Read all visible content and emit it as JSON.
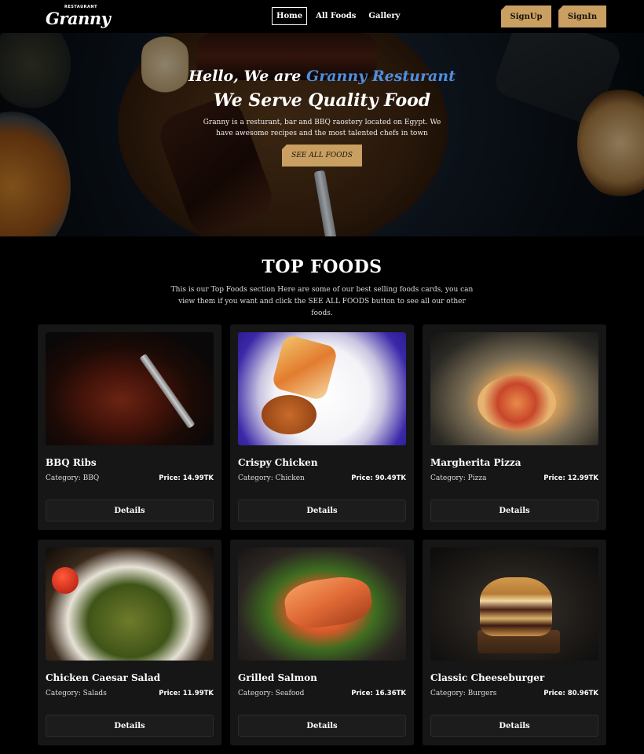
{
  "nav": {
    "logo_small": "RESTAURANT",
    "logo_big": "Granny",
    "links": [
      "Home",
      "All Foods",
      "Gallery"
    ],
    "signup": "SignUp",
    "signin": "SignIn"
  },
  "hero": {
    "title_prefix": "Hello, We are ",
    "title_brand": "Granny Resturant",
    "subtitle": "We Serve Quality Food",
    "description": "Granny is a resturant, bar and BBQ raostery located on Egypt. We have awesome recipes and the most talented chefs in town",
    "button": "SEE ALL FOODS"
  },
  "top_foods": {
    "title": "TOP FOODS",
    "description": "This is our Top Foods section Here are some of our best selling foods cards, you can view them if you want and click the SEE ALL FOODS button to see all our other foods.",
    "details_label": "Details",
    "items": [
      {
        "name": "BBQ Ribs",
        "category": "Category: BBQ",
        "price": "Price: 14.99TK"
      },
      {
        "name": "Crispy Chicken",
        "category": "Category: Chicken",
        "price": "Price: 90.49TK"
      },
      {
        "name": "Margherita Pizza",
        "category": "Category: Pizza",
        "price": "Price: 12.99TK"
      },
      {
        "name": "Chicken Caesar Salad",
        "category": "Category: Salads",
        "price": "Price: 11.99TK"
      },
      {
        "name": "Grilled Salmon",
        "category": "Category: Seafood",
        "price": "Price: 16.36TK"
      },
      {
        "name": "Classic Cheeseburger",
        "category": "Category: Burgers",
        "price": "Price: 80.96TK"
      }
    ]
  },
  "colors": {
    "accent": "#c99f62",
    "brand_blue": "#4f8fe0",
    "card_bg": "#161616"
  }
}
